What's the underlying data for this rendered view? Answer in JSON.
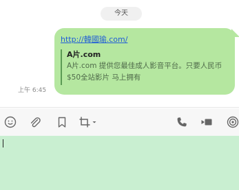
{
  "chat": {
    "date_divider": "今天",
    "timestamp": "上午 6:45",
    "message": {
      "link_text": "http://韓國瑜.com/",
      "preview": {
        "title": "A片.com",
        "description": "A片.com 提供您最佳成人影音平台。只要人民币$50全站影片 马上拥有"
      }
    }
  },
  "toolbar": {
    "icons": [
      "emoji-icon",
      "attach-icon",
      "bookmark-icon",
      "crop-icon",
      "chevron-down-icon",
      "phone-icon",
      "video-call-icon",
      "broadcast-icon"
    ]
  },
  "composer": {
    "value": ""
  },
  "colors": {
    "bubble": "#b5e7a0",
    "composer_bg": "#c9efd1",
    "link": "#1e5bd8"
  }
}
